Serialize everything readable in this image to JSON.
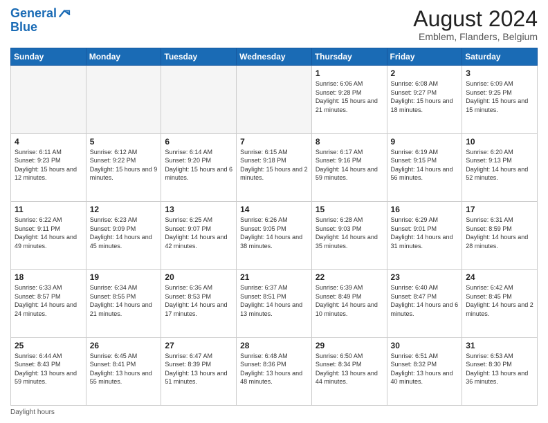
{
  "header": {
    "logo_line1": "General",
    "logo_line2": "Blue",
    "main_title": "August 2024",
    "subtitle": "Emblem, Flanders, Belgium"
  },
  "days_of_week": [
    "Sunday",
    "Monday",
    "Tuesday",
    "Wednesday",
    "Thursday",
    "Friday",
    "Saturday"
  ],
  "footer": {
    "daylight_label": "Daylight hours"
  },
  "weeks": [
    {
      "days": [
        {
          "num": "",
          "empty": true
        },
        {
          "num": "",
          "empty": true
        },
        {
          "num": "",
          "empty": true
        },
        {
          "num": "",
          "empty": true
        },
        {
          "num": "1",
          "rise": "6:06 AM",
          "set": "9:28 PM",
          "daylight": "15 hours and 21 minutes."
        },
        {
          "num": "2",
          "rise": "6:08 AM",
          "set": "9:27 PM",
          "daylight": "15 hours and 18 minutes."
        },
        {
          "num": "3",
          "rise": "6:09 AM",
          "set": "9:25 PM",
          "daylight": "15 hours and 15 minutes."
        }
      ]
    },
    {
      "days": [
        {
          "num": "4",
          "rise": "6:11 AM",
          "set": "9:23 PM",
          "daylight": "15 hours and 12 minutes."
        },
        {
          "num": "5",
          "rise": "6:12 AM",
          "set": "9:22 PM",
          "daylight": "15 hours and 9 minutes."
        },
        {
          "num": "6",
          "rise": "6:14 AM",
          "set": "9:20 PM",
          "daylight": "15 hours and 6 minutes."
        },
        {
          "num": "7",
          "rise": "6:15 AM",
          "set": "9:18 PM",
          "daylight": "15 hours and 2 minutes."
        },
        {
          "num": "8",
          "rise": "6:17 AM",
          "set": "9:16 PM",
          "daylight": "14 hours and 59 minutes."
        },
        {
          "num": "9",
          "rise": "6:19 AM",
          "set": "9:15 PM",
          "daylight": "14 hours and 56 minutes."
        },
        {
          "num": "10",
          "rise": "6:20 AM",
          "set": "9:13 PM",
          "daylight": "14 hours and 52 minutes."
        }
      ]
    },
    {
      "days": [
        {
          "num": "11",
          "rise": "6:22 AM",
          "set": "9:11 PM",
          "daylight": "14 hours and 49 minutes."
        },
        {
          "num": "12",
          "rise": "6:23 AM",
          "set": "9:09 PM",
          "daylight": "14 hours and 45 minutes."
        },
        {
          "num": "13",
          "rise": "6:25 AM",
          "set": "9:07 PM",
          "daylight": "14 hours and 42 minutes."
        },
        {
          "num": "14",
          "rise": "6:26 AM",
          "set": "9:05 PM",
          "daylight": "14 hours and 38 minutes."
        },
        {
          "num": "15",
          "rise": "6:28 AM",
          "set": "9:03 PM",
          "daylight": "14 hours and 35 minutes."
        },
        {
          "num": "16",
          "rise": "6:29 AM",
          "set": "9:01 PM",
          "daylight": "14 hours and 31 minutes."
        },
        {
          "num": "17",
          "rise": "6:31 AM",
          "set": "8:59 PM",
          "daylight": "14 hours and 28 minutes."
        }
      ]
    },
    {
      "days": [
        {
          "num": "18",
          "rise": "6:33 AM",
          "set": "8:57 PM",
          "daylight": "14 hours and 24 minutes."
        },
        {
          "num": "19",
          "rise": "6:34 AM",
          "set": "8:55 PM",
          "daylight": "14 hours and 21 minutes."
        },
        {
          "num": "20",
          "rise": "6:36 AM",
          "set": "8:53 PM",
          "daylight": "14 hours and 17 minutes."
        },
        {
          "num": "21",
          "rise": "6:37 AM",
          "set": "8:51 PM",
          "daylight": "14 hours and 13 minutes."
        },
        {
          "num": "22",
          "rise": "6:39 AM",
          "set": "8:49 PM",
          "daylight": "14 hours and 10 minutes."
        },
        {
          "num": "23",
          "rise": "6:40 AM",
          "set": "8:47 PM",
          "daylight": "14 hours and 6 minutes."
        },
        {
          "num": "24",
          "rise": "6:42 AM",
          "set": "8:45 PM",
          "daylight": "14 hours and 2 minutes."
        }
      ]
    },
    {
      "days": [
        {
          "num": "25",
          "rise": "6:44 AM",
          "set": "8:43 PM",
          "daylight": "13 hours and 59 minutes."
        },
        {
          "num": "26",
          "rise": "6:45 AM",
          "set": "8:41 PM",
          "daylight": "13 hours and 55 minutes."
        },
        {
          "num": "27",
          "rise": "6:47 AM",
          "set": "8:39 PM",
          "daylight": "13 hours and 51 minutes."
        },
        {
          "num": "28",
          "rise": "6:48 AM",
          "set": "8:36 PM",
          "daylight": "13 hours and 48 minutes."
        },
        {
          "num": "29",
          "rise": "6:50 AM",
          "set": "8:34 PM",
          "daylight": "13 hours and 44 minutes."
        },
        {
          "num": "30",
          "rise": "6:51 AM",
          "set": "8:32 PM",
          "daylight": "13 hours and 40 minutes."
        },
        {
          "num": "31",
          "rise": "6:53 AM",
          "set": "8:30 PM",
          "daylight": "13 hours and 36 minutes."
        }
      ]
    }
  ]
}
